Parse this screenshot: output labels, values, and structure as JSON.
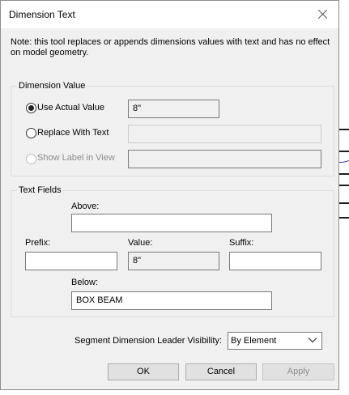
{
  "window": {
    "title": "Dimension Text"
  },
  "note": "Note: this tool replaces or appends dimensions values with text and has no effect on model geometry.",
  "dimension_value": {
    "legend": "Dimension Value",
    "use_actual": {
      "label": "Use Actual Value",
      "value": "8\"",
      "selected": true
    },
    "replace_with_text": {
      "label": "Replace With Text",
      "value": "",
      "selected": false
    },
    "show_label": {
      "label": "Show Label in View",
      "value": "",
      "enabled": false
    }
  },
  "text_fields": {
    "legend": "Text Fields",
    "above": {
      "label": "Above:",
      "value": ""
    },
    "prefix": {
      "label": "Prefix:",
      "value": ""
    },
    "value": {
      "label": "Value:",
      "value": "8\""
    },
    "suffix": {
      "label": "Suffix:",
      "value": ""
    },
    "below": {
      "label": "Below:",
      "value": "BOX BEAM"
    }
  },
  "leader_visibility": {
    "label": "Segment Dimension Leader Visibility:",
    "selected": "By Element"
  },
  "buttons": {
    "ok": "OK",
    "cancel": "Cancel",
    "apply": "Apply"
  }
}
